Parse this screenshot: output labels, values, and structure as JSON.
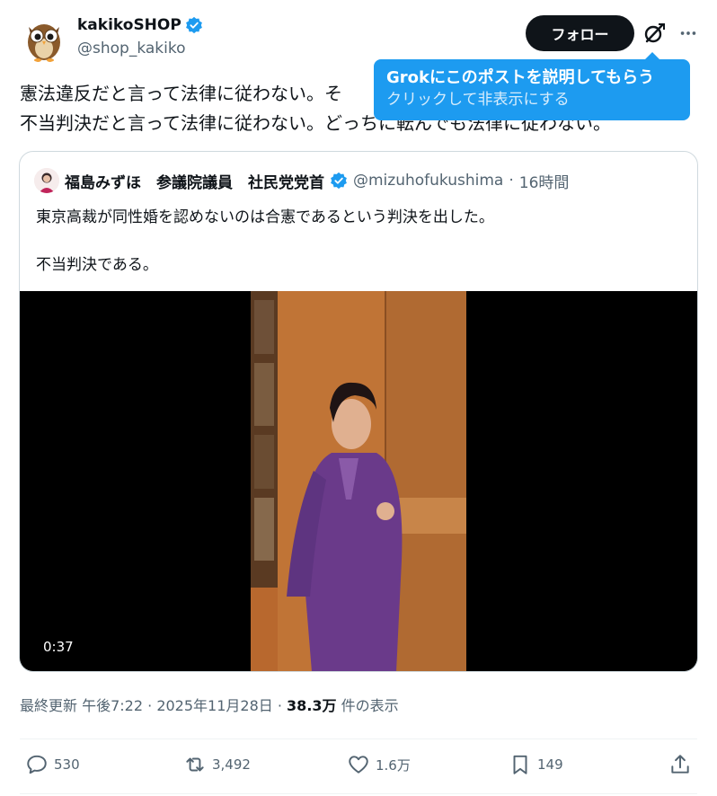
{
  "author": {
    "display_name": "kakikoSHOP",
    "handle": "@shop_kakiko",
    "verified": true
  },
  "header": {
    "follow_label": "フォロー",
    "grok_icon": "grok-icon",
    "more_icon": "more-icon"
  },
  "tooltip": {
    "title": "Grokにこのポストを説明してもらう",
    "subtitle": "クリックして非表示にする"
  },
  "post": {
    "line1": "憲法違反だと言って法律に従わない。そ",
    "line2": "不当判決だと言って法律に従わない。どっちに転んでも法律に従わない。"
  },
  "quote": {
    "display_name": "福島みずほ　参議院議員　社民党党首",
    "handle": "@mizuhofukushima",
    "separator": "·",
    "time": "16時間",
    "text_line1": "東京高裁が同性婚を認めないのは合憲であるという判決を出した。",
    "text_line2": "不当判決である。",
    "video_duration": "0:37"
  },
  "meta": {
    "updated_label": "最終更新 午後7:22",
    "dot1": "·",
    "date": "2025年11月28日",
    "dot2": "·",
    "views": "38.3万",
    "views_suffix": "件の表示"
  },
  "actions": {
    "replies": "530",
    "reposts": "3,492",
    "likes": "1.6万",
    "bookmarks": "149"
  },
  "colors": {
    "accent": "#1d9bf0",
    "text": "#0f1419",
    "secondary": "#536471",
    "border": "#cfd9de"
  }
}
